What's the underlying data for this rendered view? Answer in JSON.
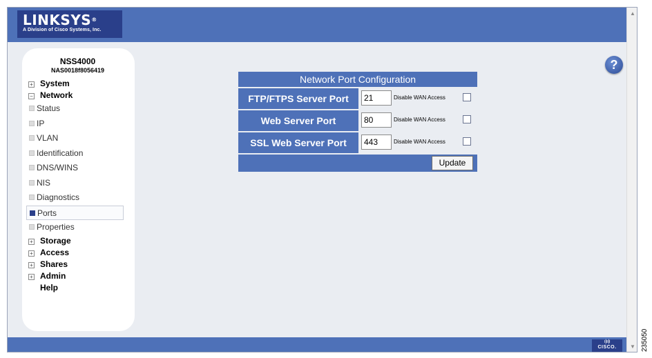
{
  "brand": {
    "logo_text": "LINKSYS",
    "logo_reg": "®",
    "subtitle": "A Division of Cisco Systems, Inc.",
    "footer_logo_bars": "ı|ıı|ı",
    "footer_logo_text": "CISCO."
  },
  "device": {
    "model": "NSS4000",
    "mac": "NAS0018f8056419"
  },
  "sidebar": {
    "system": "System",
    "network": "Network",
    "network_items": [
      {
        "label": "Status"
      },
      {
        "label": "IP"
      },
      {
        "label": "VLAN"
      },
      {
        "label": "Identification"
      },
      {
        "label": "DNS/WINS"
      },
      {
        "label": "NIS"
      },
      {
        "label": "Diagnostics"
      },
      {
        "label": "Ports",
        "active": true
      },
      {
        "label": "Properties"
      }
    ],
    "storage": "Storage",
    "access": "Access",
    "shares": "Shares",
    "admin": "Admin",
    "help": "Help",
    "collapsed_glyph": "+",
    "expanded_glyph": "−"
  },
  "help_icon": "?",
  "panel": {
    "title": "Network Port Configuration",
    "rows": [
      {
        "label": "FTP/FTPS Server Port",
        "value": "21",
        "disable_label": "Disable WAN Access",
        "checked": false
      },
      {
        "label": "Web Server Port",
        "value": "80",
        "disable_label": "Disable WAN Access",
        "checked": false
      },
      {
        "label": "SSL Web Server Port",
        "value": "443",
        "disable_label": "Disable WAN Access",
        "checked": false
      }
    ],
    "update_label": "Update"
  },
  "figure_id": "235050",
  "colors": {
    "header_blue": "#4e71b8",
    "logo_navy": "#2a3f8a",
    "content_bg": "#eaedf2"
  }
}
